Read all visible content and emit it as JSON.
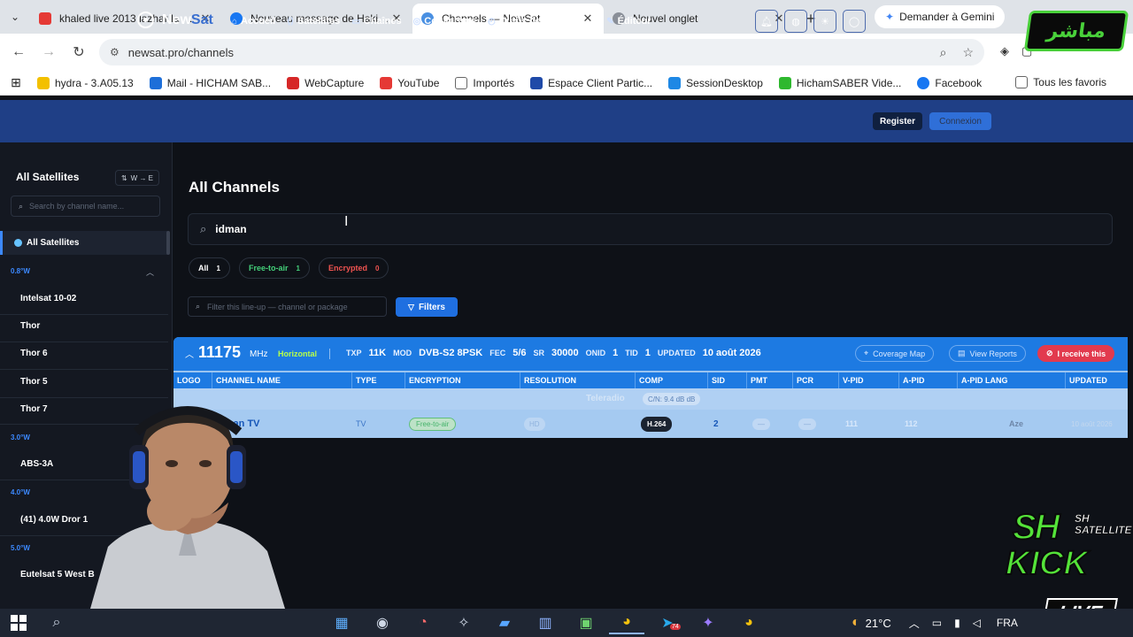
{
  "browser": {
    "tabs": [
      {
        "title": "khaled live 2013 lazhar la mim",
        "color": "#e53935",
        "active": false
      },
      {
        "title": "Nouveau message de Hakim d",
        "color": "#1877f2",
        "active": false
      },
      {
        "title": "Channels — NewSat",
        "color": "#4a90e2",
        "active": true
      },
      {
        "title": "Nouvel onglet",
        "color": "#8a8f98",
        "active": false
      }
    ],
    "gemini_label": "Demander à Gemini",
    "url": "newsat.pro/channels",
    "bookmarks": [
      {
        "label": "hydra - 3.A05.13",
        "color": "#f3c000"
      },
      {
        "label": "Mail - HICHAM SAB...",
        "color": "#1e6fd9"
      },
      {
        "label": "WebCapture",
        "color": "#d62828"
      },
      {
        "label": "YouTube",
        "color": "#e53935"
      },
      {
        "label": "Importés",
        "color": "#7a7a7a"
      },
      {
        "label": "Espace Client Partic...",
        "color": "#1f4aa8"
      },
      {
        "label": "SessionDesktop",
        "color": "#1e88e5"
      },
      {
        "label": "HichamSABER Vide...",
        "color": "#2eb82e"
      },
      {
        "label": "Facebook",
        "color": "#1877f2"
      }
    ],
    "bookmarks_all": "Tous les favoris"
  },
  "site": {
    "logo_a": "New",
    "logo_b": "Sat",
    "nav": [
      {
        "label": "Accueil",
        "icon": "⌂"
      },
      {
        "label": "Satellites",
        "icon": "⟨⟩"
      },
      {
        "label": "Chaînes",
        "icon": "▭"
      },
      {
        "label": "Couverture",
        "icon": "◎"
      },
      {
        "label": "Outils de parabole",
        "icon": "◴"
      },
      {
        "label": "Éditeur",
        "icon": "✎"
      }
    ],
    "register": "Register",
    "login": "Connexion"
  },
  "sidebar": {
    "title": "All Satellites",
    "sort": "W → E",
    "search_placeholder": "Search by channel name...",
    "all_label": "All Satellites",
    "groups": [
      {
        "name": "0.8°W",
        "items": [
          "Intelsat 10-02",
          "Thor",
          "Thor 6",
          "Thor 5",
          "Thor 7"
        ]
      },
      {
        "name": "3.0°W",
        "items": [
          "ABS-3A"
        ]
      },
      {
        "name": "4.0°W",
        "items": [
          "(41) 4.0W Dror 1"
        ]
      },
      {
        "name": "5.0°W",
        "items": [
          "Eutelsat 5 West B"
        ]
      }
    ]
  },
  "main": {
    "title": "All Channels",
    "search_value": "idman",
    "pills": [
      {
        "label": "All",
        "count": "1"
      },
      {
        "label": "Free-to-air",
        "count": "1"
      },
      {
        "label": "Encrypted",
        "count": "0"
      }
    ],
    "lineup_placeholder": "Filter this line-up — channel or package",
    "filters_label": "Filters"
  },
  "transponder": {
    "freq": "11175",
    "unit": "MHz",
    "polarization": "Horizontal",
    "txp_k": "TXP",
    "txp_v": "11K",
    "mod_k": "MOD",
    "mod_v": "DVB-S2 8PSK",
    "fec_k": "FEC",
    "fec_v": "5/6",
    "sr_k": "SR",
    "sr_v": "30000",
    "onid_k": "ONID",
    "onid_v": "1",
    "tid_k": "TID",
    "tid_v": "1",
    "upd_k": "UPDATED",
    "upd_v": "10 août 2026",
    "coverage": "Coverage Map",
    "reports": "View Reports",
    "receive": "I receive this",
    "columns": [
      "LOGO",
      "CHANNEL NAME",
      "TYPE",
      "ENCRYPTION",
      "RESOLUTION",
      "COMP",
      "SID",
      "PMT",
      "PCR",
      "V-PID",
      "A-PID",
      "A-PID LANG",
      "UPDATED"
    ],
    "package": "Teleradio",
    "cn": "C/N: 9.4 dB dB",
    "channel": {
      "name": "İdman TV",
      "type": "TV",
      "encryption": "Free-to-air",
      "resolution": "HD",
      "comp": "H.264",
      "sid": "2",
      "pmt": "—",
      "pcr": "—",
      "vpid": "111",
      "apid": "112",
      "lang": "Aze",
      "updated": "10 août 2026"
    }
  },
  "overlay": {
    "mubasher": "مباشر",
    "brand_sh": "SH",
    "brand_sat1": "SH",
    "brand_sat2": "SATELLITE",
    "brand_kick": "KICK",
    "brand_live": "LIVE"
  },
  "taskbar": {
    "weather": "21°C",
    "lang": "FRA",
    "badge": "74"
  }
}
